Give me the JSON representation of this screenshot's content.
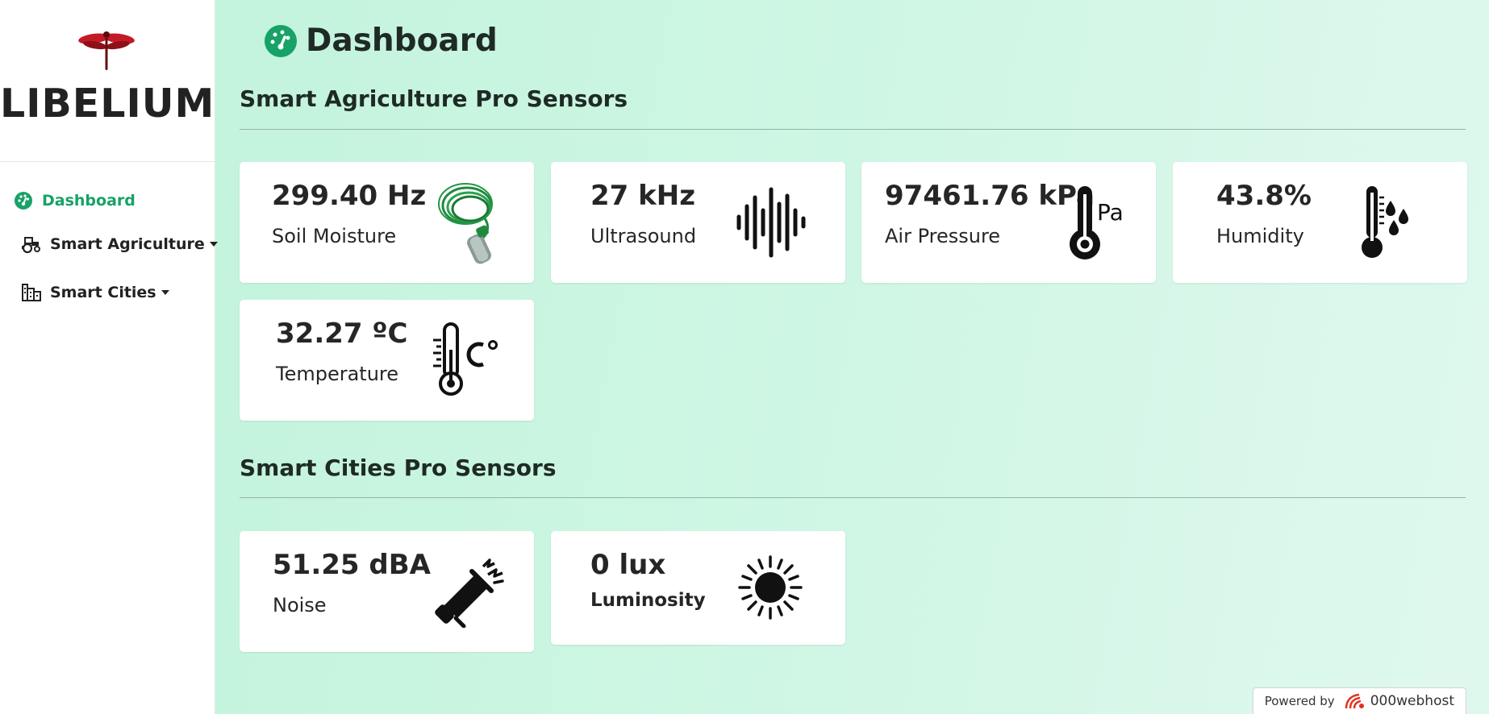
{
  "brand": {
    "name": "LIBELIUM",
    "logo_icon": "dragonfly-icon",
    "logo_color": "#b3151f"
  },
  "sidebar": {
    "items": [
      {
        "label": "Dashboard",
        "icon": "gauge-icon",
        "active": true
      },
      {
        "label": "Smart Agriculture",
        "icon": "tractor-icon",
        "dropdown": true
      },
      {
        "label": "Smart Cities",
        "icon": "city-icon",
        "dropdown": true
      }
    ]
  },
  "header": {
    "title": "Dashboard",
    "icon": "gauge-icon"
  },
  "sections": [
    {
      "title": "Smart Agriculture Pro Sensors",
      "cards": [
        {
          "value": "299.40 Hz",
          "label": "Soil Moisture",
          "icon": "soil-probe-icon"
        },
        {
          "value": "27 kHz",
          "label": "Ultrasound",
          "icon": "soundwave-icon"
        },
        {
          "value": "97461.76 kPa",
          "label": "Air Pressure",
          "icon": "thermometer-pa-icon"
        },
        {
          "value": "43.8%",
          "label": "Humidity",
          "icon": "thermometer-drops-icon"
        },
        {
          "value": "32.27 ºC",
          "label": "Temperature",
          "icon": "thermometer-celsius-icon"
        }
      ]
    },
    {
      "title": "Smart Cities Pro Sensors",
      "cards": [
        {
          "value": "51.25 dBA",
          "label": "Noise",
          "icon": "megaphone-icon"
        },
        {
          "value": "0 lux",
          "label": "Luminosity",
          "icon": "sun-icon"
        }
      ]
    }
  ],
  "footer": {
    "powered_by": "Powered by",
    "host": "000webhost"
  },
  "colors": {
    "accent": "#17a266",
    "background": "#c6f4de"
  }
}
